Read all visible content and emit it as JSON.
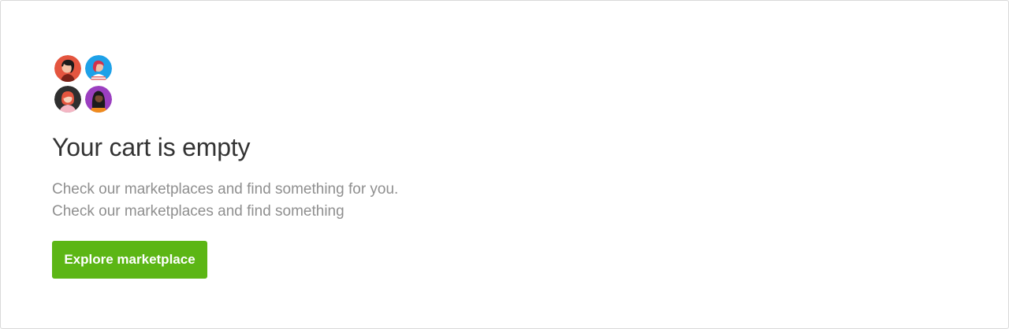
{
  "empty_state": {
    "avatars": [
      {
        "icon": "person-avatar-icon",
        "bg": "#e4553f"
      },
      {
        "icon": "person-avatar-icon",
        "bg": "#1ea1e8"
      },
      {
        "icon": "person-avatar-icon",
        "bg": "#2f2f2f"
      },
      {
        "icon": "person-avatar-icon",
        "bg": "#9b3fc0"
      }
    ],
    "title": "Your cart is empty",
    "description_lines": [
      "Check our marketplaces and find something for you.",
      "Check our marketplaces and find something"
    ],
    "cta_label": "Explore marketplace"
  },
  "colors": {
    "accent": "#5cb615",
    "title": "#333333",
    "description": "#8f8f8f",
    "border": "#d9d9d9"
  }
}
